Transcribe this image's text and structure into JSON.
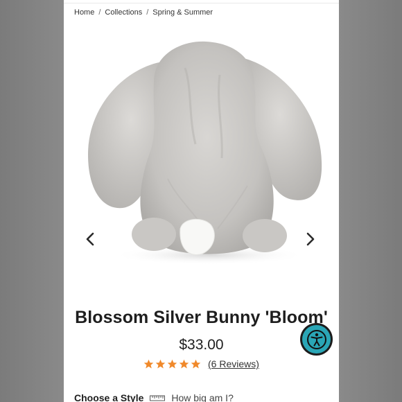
{
  "breadcrumb": {
    "items": [
      "Home",
      "Collections",
      "Spring & Summer"
    ],
    "separator": "/"
  },
  "gallery": {
    "image_subject": "silver plush bunny seen from behind",
    "prev_icon": "chevron-left-icon",
    "next_icon": "chevron-right-icon"
  },
  "product": {
    "title": "Blossom Silver Bunny 'Bloom'",
    "price": "$33.00",
    "rating": 5,
    "rating_max": 5,
    "reviews_label": "(6 Reviews)",
    "star_color": "#f0892b"
  },
  "options": {
    "choose_style_label": "Choose a Style",
    "size_guide_icon": "ruler-icon",
    "size_guide_label": "How big am I?"
  },
  "accessibility": {
    "icon": "accessibility-icon",
    "color": "#2aa6b6"
  }
}
